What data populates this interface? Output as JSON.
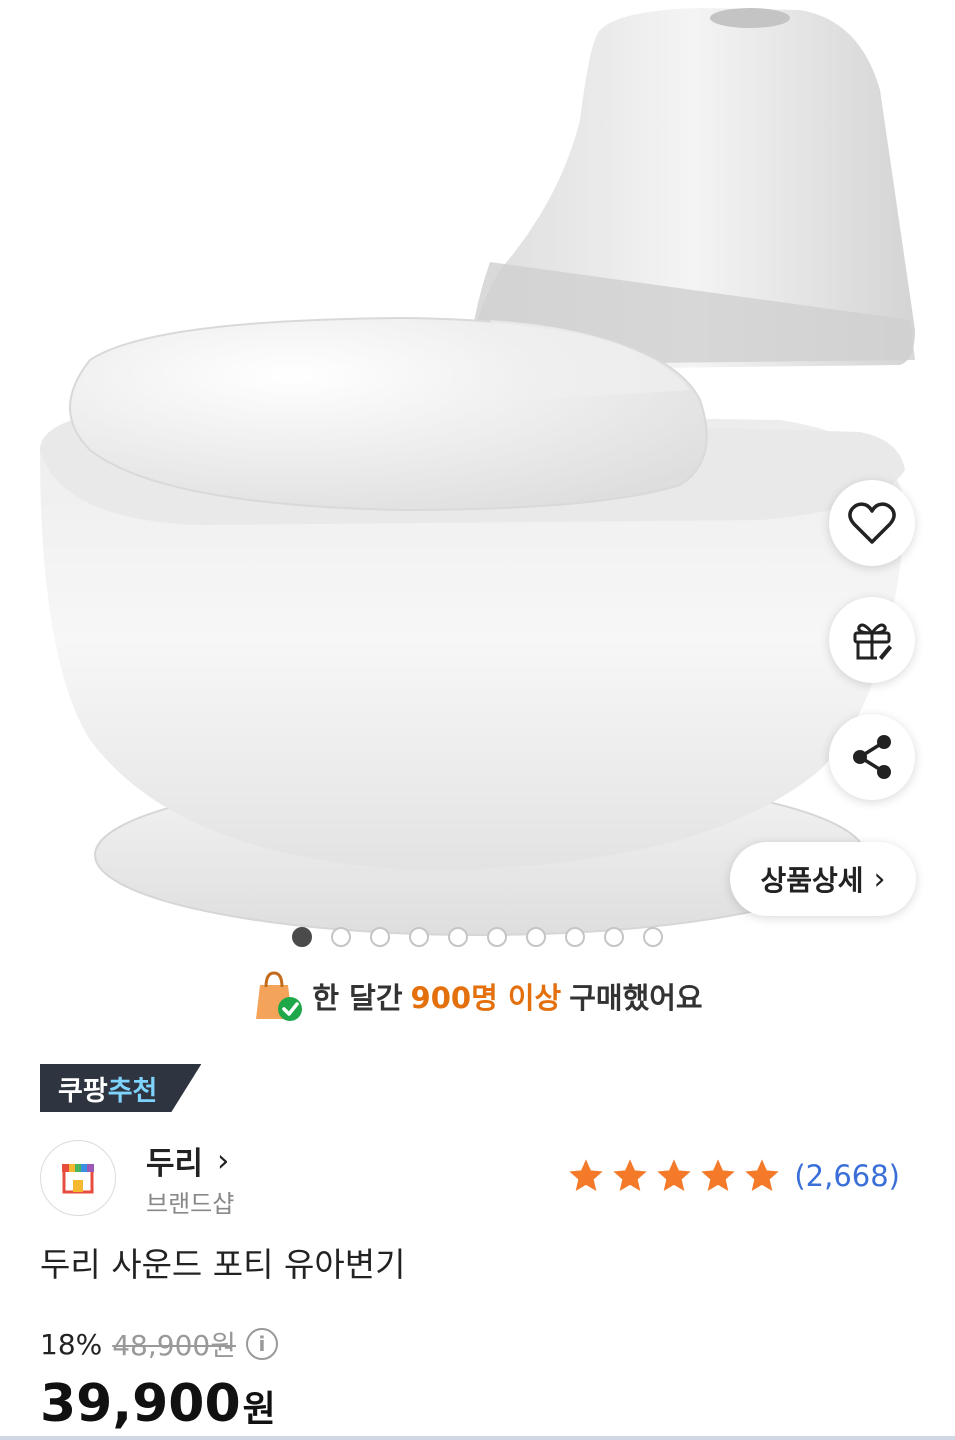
{
  "hero": {
    "image_alt": "두리 사운드 포티 유아변기",
    "gallery_total": 10,
    "gallery_active": 0,
    "actions": [
      {
        "name": "wishlist",
        "icon": "heart-icon"
      },
      {
        "name": "gift",
        "icon": "gift-icon"
      },
      {
        "name": "share",
        "icon": "share-icon"
      }
    ],
    "detail_label": "상품상세"
  },
  "purchase_info": {
    "prefix": "한 달간",
    "highlight": "900명 이상",
    "suffix": "구매했어요",
    "highlight_color": "#e3700c"
  },
  "badge": {
    "part1": "쿠팡",
    "part2": "추천"
  },
  "brand": {
    "name": "두리",
    "sub": "브랜드샵"
  },
  "rating": {
    "stars": 5,
    "count": "(2,668)",
    "star_color": "#f47a2a"
  },
  "product": {
    "title": "두리 사운드 포티 유아변기",
    "discount": "18%",
    "original_price": "48,900원",
    "price": "39,900",
    "price_unit": "원"
  }
}
